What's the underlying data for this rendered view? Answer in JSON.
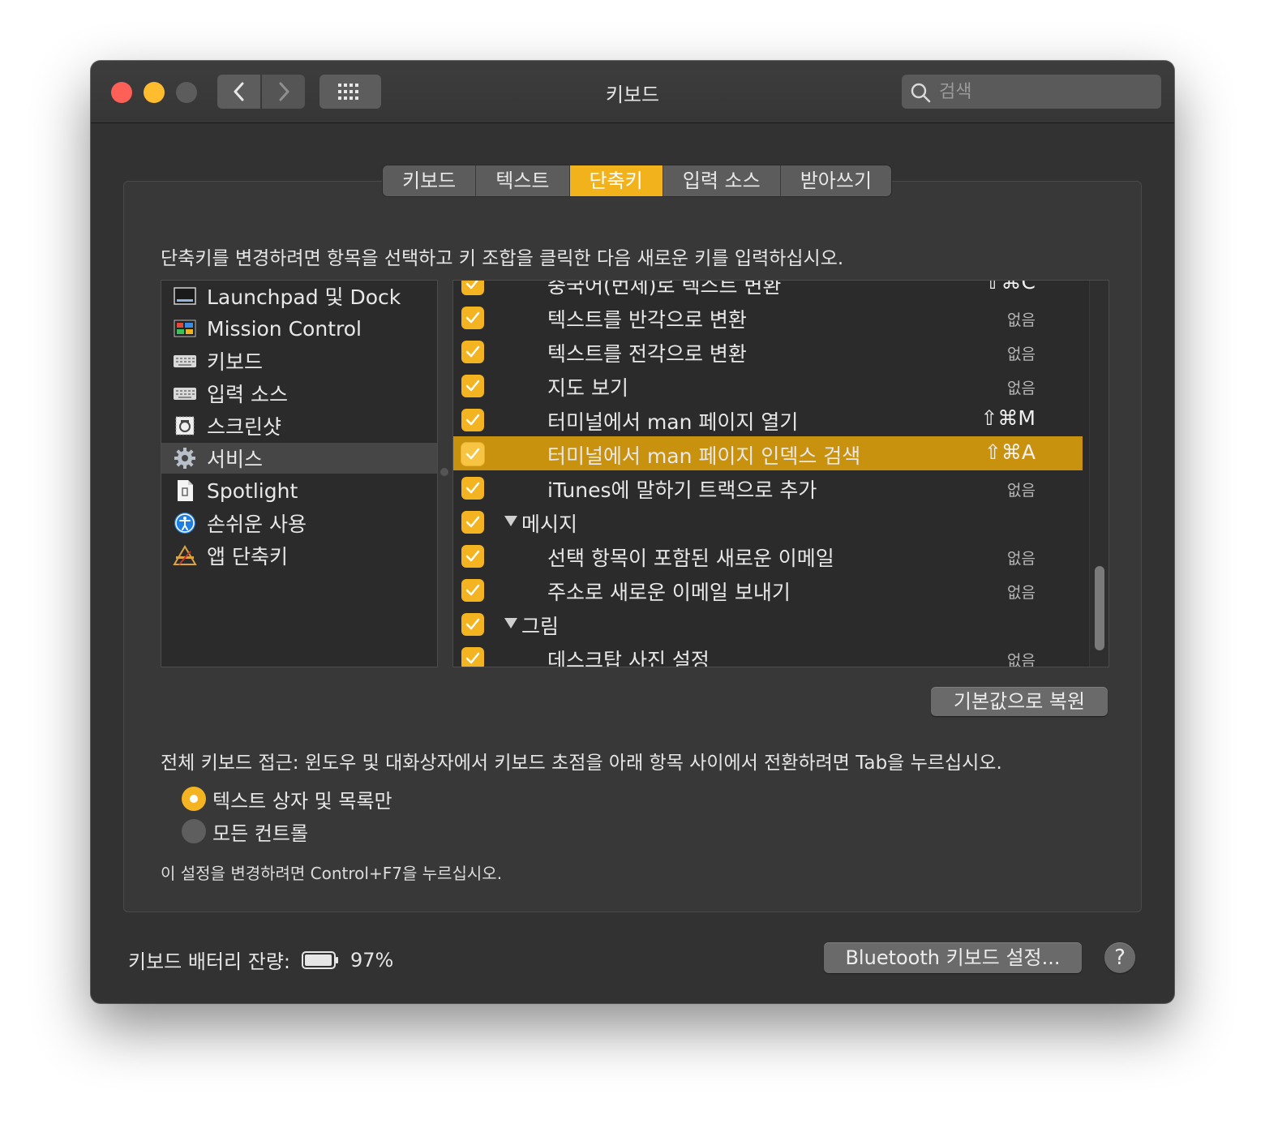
{
  "window": {
    "title": "키보드",
    "search_placeholder": "검색"
  },
  "tabs": [
    {
      "label": "키보드"
    },
    {
      "label": "텍스트"
    },
    {
      "label": "단축키",
      "active": true
    },
    {
      "label": "입력 소스"
    },
    {
      "label": "받아쓰기"
    }
  ],
  "instruction": "단축키를 변경하려면 항목을 선택하고 키 조합을 클릭한 다음 새로운 키를 입력하십시오.",
  "categories": [
    {
      "label": "Launchpad 및 Dock",
      "icon": "launchpad-dock-icon"
    },
    {
      "label": "Mission Control",
      "icon": "mission-control-icon"
    },
    {
      "label": "키보드",
      "icon": "keyboard-icon"
    },
    {
      "label": "입력 소스",
      "icon": "input-sources-icon"
    },
    {
      "label": "스크린샷",
      "icon": "screenshot-icon"
    },
    {
      "label": "서비스",
      "icon": "gear-icon",
      "selected": true
    },
    {
      "label": "Spotlight",
      "icon": "spotlight-icon"
    },
    {
      "label": "손쉬운 사용",
      "icon": "accessibility-icon"
    },
    {
      "label": "앱 단축키",
      "icon": "app-shortcuts-icon"
    }
  ],
  "shortcuts": [
    {
      "label": "중국어(번체)로 텍스트 변환",
      "shortcut": "^⇧⌘C",
      "checked": true
    },
    {
      "label": "텍스트를 반각으로 변환",
      "shortcut": "없음",
      "checked": true
    },
    {
      "label": "텍스트를 전각으로 변환",
      "shortcut": "없음",
      "checked": true
    },
    {
      "label": "지도 보기",
      "shortcut": "없음",
      "checked": true
    },
    {
      "label": "터미널에서 man 페이지 열기",
      "shortcut": "⇧⌘M",
      "checked": true
    },
    {
      "label": "터미널에서 man 페이지 인덱스 검색",
      "shortcut": "⇧⌘A",
      "checked": true,
      "selected": true
    },
    {
      "label": "iTunes에 말하기 트랙으로 추가",
      "shortcut": "없음",
      "checked": true
    },
    {
      "label": "메시지",
      "group": true,
      "checked": true
    },
    {
      "label": "선택 항목이 포함된 새로운 이메일",
      "shortcut": "없음",
      "checked": true
    },
    {
      "label": "주소로 새로운 이메일 보내기",
      "shortcut": "없음",
      "checked": true
    },
    {
      "label": "그림",
      "group": true,
      "checked": true
    },
    {
      "label": "데스크탑 사진 설정",
      "shortcut": "없음",
      "checked": true
    }
  ],
  "restore_button": "기본값으로 복원",
  "full_keyboard_access": "전체 키보드 접근: 윈도우 및 대화상자에서 키보드 초점을 아래 항목 사이에서 전환하려면 Tab을 누르십시오.",
  "radio_options": [
    {
      "label": "텍스트 상자 및 목록만",
      "selected": true
    },
    {
      "label": "모든 컨트롤",
      "selected": false
    }
  ],
  "hint": "이 설정을 변경하려면 Control+F7을 누르십시오.",
  "battery": {
    "label": "키보드 배터리 잔량:",
    "value": "97%",
    "level": 0.97
  },
  "bluetooth_button": "Bluetooth 키보드 설정...",
  "help_button": "?",
  "colors": {
    "accent": "#f2b21c",
    "selection": "#c9920e"
  }
}
